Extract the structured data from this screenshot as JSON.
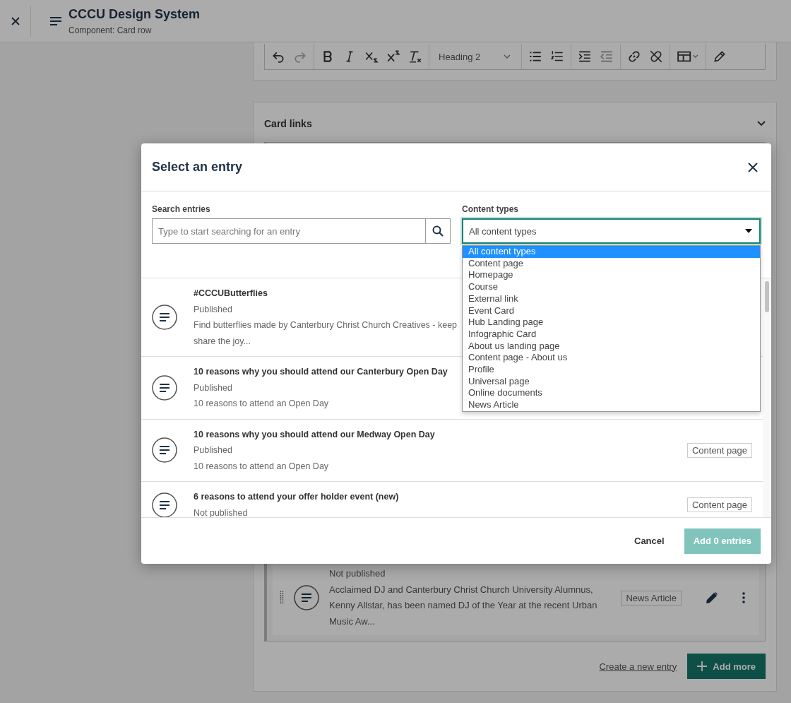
{
  "app_bar": {
    "title": "CCCU Design System",
    "subtitle": "Component: Card row"
  },
  "editor_toolbar": {
    "heading_select": "Heading 2"
  },
  "card_links": {
    "title": "Card links",
    "entry": {
      "status": "Not published",
      "description_lines": [
        "Acclaimed DJ and Canterbury Christ Church University Alumnus,",
        "Kenny Allstar, has been named DJ of the Year at the recent Urban",
        "Music Aw..."
      ],
      "type": "News Article"
    },
    "create_link": "Create a new entry",
    "add_button": "Add more"
  },
  "dialog": {
    "title": "Select an entry",
    "search": {
      "label": "Search entries",
      "placeholder": "Type to start searching for an entry"
    },
    "content_types": {
      "label": "Content types",
      "value": "All content types",
      "expanded": true,
      "options": [
        {
          "label": "All content types",
          "selected": true
        },
        {
          "label": "Content page",
          "selected": false
        },
        {
          "label": "Homepage",
          "selected": false
        },
        {
          "label": "Course",
          "selected": false
        },
        {
          "label": "External link",
          "selected": false
        },
        {
          "label": "Event Card",
          "selected": false
        },
        {
          "label": "Hub Landing page",
          "selected": false
        },
        {
          "label": "Infographic Card",
          "selected": false
        },
        {
          "label": "About us landing page",
          "selected": false
        },
        {
          "label": "Content page - About us",
          "selected": false
        },
        {
          "label": "Profile",
          "selected": false
        },
        {
          "label": "Universal page",
          "selected": false
        },
        {
          "label": "Online documents",
          "selected": false
        },
        {
          "label": "News Article",
          "selected": false
        }
      ]
    },
    "entries": [
      {
        "title": "#CCCUButterflies",
        "status": "Published",
        "description_lines": [
          "Find butterflies made by Canterbury Christ Church Creatives - keep",
          "share the joy..."
        ]
      },
      {
        "title": "10 reasons why you should attend our Canterbury Open Day",
        "status": "Published",
        "description_lines": [
          "10 reasons to attend an Open Day"
        ]
      },
      {
        "title": "10 reasons why you should attend our Medway Open Day",
        "status": "Published",
        "description_lines": [
          "10 reasons to attend an Open Day"
        ],
        "type": "Content page"
      },
      {
        "title": "6 reasons to attend your offer holder event (new)",
        "status": "Not published",
        "type": "Content page"
      }
    ],
    "cancel": "Cancel",
    "add_button": {
      "label": "Add 0 entries",
      "disabled": true
    }
  }
}
